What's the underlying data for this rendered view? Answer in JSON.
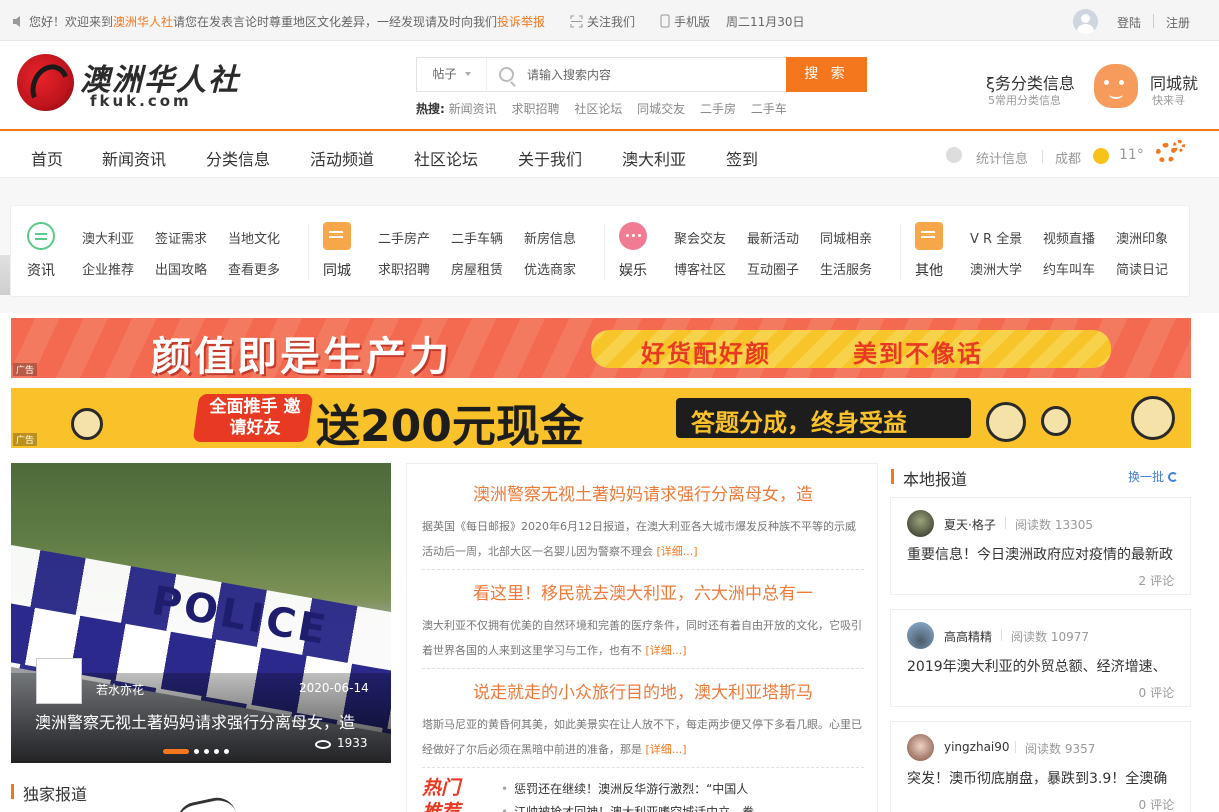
{
  "topbar": {
    "welcome_prefix": "您好！欢迎来到",
    "site_name": "澳洲华人社",
    "welcome_suffix": "请您在发表言论时尊重地区文化差异，一经发现请及时向我们",
    "report_link": "投诉举报",
    "follow": "关注我们",
    "mobile": "手机版",
    "date": "周二11月30日",
    "login": "登陆",
    "register": "注册"
  },
  "logo": {
    "text": "澳洲华人社",
    "sub": "fkuk.com"
  },
  "search": {
    "type": "帖子",
    "placeholder": "请输入搜索内容",
    "button": "搜 索",
    "hot_label": "热搜:",
    "hot_keywords": [
      "新闻资讯",
      "求职招聘",
      "社区论坛",
      "同城交友",
      "二手房",
      "二手车"
    ]
  },
  "header_services": [
    {
      "title": "ξ务分类信息",
      "sub": "5常用分类信息"
    },
    {
      "title": "同城就",
      "sub": "快来寻"
    }
  ],
  "nav": {
    "items": [
      "首页",
      "新闻资讯",
      "分类信息",
      "活动频道",
      "社区论坛",
      "关于我们",
      "澳大利亚",
      "签到"
    ],
    "stats": "统计信息",
    "city": "成都",
    "temperature": "11°"
  },
  "categories": [
    {
      "name": "资讯",
      "icon": "list-icon",
      "links": [
        "澳大利亚",
        "签证需求",
        "当地文化",
        "企业推荐",
        "出国攻略",
        "查看更多"
      ]
    },
    {
      "name": "同城",
      "icon": "chat-icon",
      "links": [
        "二手房产",
        "二手车辆",
        "新房信息",
        "求职招聘",
        "房屋租赁",
        "优选商家"
      ]
    },
    {
      "name": "娱乐",
      "icon": "chat-bubble-icon",
      "links": [
        "聚会交友",
        "最新活动",
        "同城相亲",
        "博客社区",
        "互动圈子",
        "生活服务"
      ]
    },
    {
      "name": "其他",
      "icon": "message-icon",
      "links": [
        "V R 全景",
        "视频直播",
        "澳洲印象",
        "澳洲大学",
        "约车叫车",
        "简读日记"
      ]
    }
  ],
  "banners": [
    {
      "headline": "颜值即是生产力",
      "slogan_1": "好货配好颜",
      "slogan_2": "美到不像话",
      "tag": "广告"
    },
    {
      "pill": "全面推手 邀请好友",
      "headline": "送200元现金",
      "slogan": "答题分成，终身受益",
      "tag": "广告"
    }
  ],
  "slide": {
    "image_text": "POLICE",
    "author": "若水亦花",
    "date": "2020-06-14",
    "title": "澳洲警察无视土著妈妈请求强行分离母女，造",
    "views": "1933"
  },
  "news": [
    {
      "title": "澳洲警察无视土著妈妈请求强行分离母女，造",
      "summary": "据英国《每日邮报》2020年6月12日报道，在澳大利亚各大城市爆发反种族不平等的示威活动后一周，北部大区一名婴儿因为警察不理会",
      "more": "[详细...]"
    },
    {
      "title": "看这里！移民就去澳大利亚，六大洲中总有一",
      "summary": "澳大利亚不仅拥有优美的自然环境和完善的医疗条件，同时还有着自由开放的文化，它吸引着世界各国的人来到这里学习与工作，也有不",
      "more": "[详细...]"
    },
    {
      "title": "说走就走的小众旅行目的地，澳大利亚塔斯马",
      "summary": "塔斯马尼亚的黄昏何其美，如此美景实在让人放不下，每走两步便又停下多看几眼。心里已经做好了尔后必须在黑暗中前进的准备，那是",
      "more": "[详细...]"
    }
  ],
  "hot_recommend": {
    "label_1": "热门",
    "label_2": "推荐",
    "items": [
      "惩罚还在继续！澳洲反华游行激烈：“中国人",
      "江帅被抢才回神！澳大利亚嗜空城话中立，拳"
    ]
  },
  "exclusive": {
    "title": "独家报道"
  },
  "local": {
    "title": "本地报道",
    "refresh": "换一批",
    "read_label": "阅读数",
    "comment_label": "评论",
    "items": [
      {
        "user": "夏天·格子",
        "reads": "13305",
        "title": "重要信息！今日澳洲政府应对疫情的最新政",
        "comments": "2"
      },
      {
        "user": "高高精精",
        "reads": "10977",
        "title": "2019年澳大利亚的外贸总额、经济增速、",
        "comments": "0"
      },
      {
        "user": "yingzhai90",
        "reads": "9357",
        "title": "突发！澳币彻底崩盘，暴跌到3.9！全澳确",
        "comments": "0"
      }
    ]
  },
  "colors": {
    "accent": "#f5771d",
    "news_title": "#ee7a3a",
    "link_blue": "#3f7fd8"
  }
}
